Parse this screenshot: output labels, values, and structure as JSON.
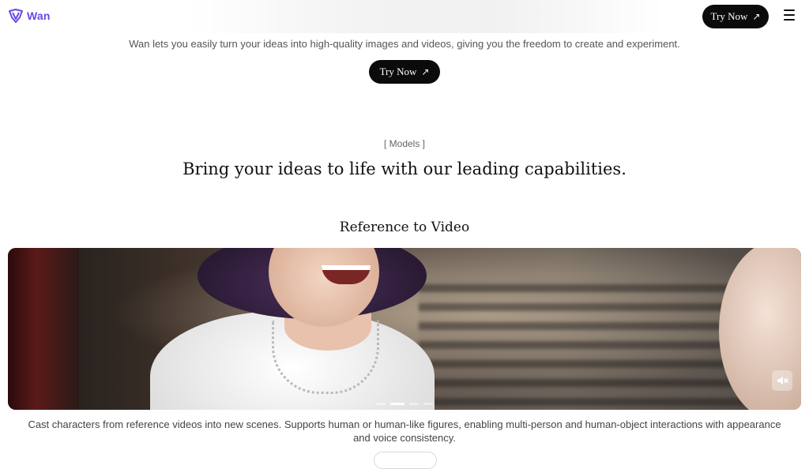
{
  "header": {
    "brand": "Wan",
    "try_now_label": "Try Now",
    "menu_icon": "hamburger-menu-icon"
  },
  "hero": {
    "description": "Wan lets you easily turn your ideas into high-quality images and videos, giving you the freedom to create and experiment.",
    "try_now_label": "Try Now",
    "button_icon": "arrow-up-right-icon"
  },
  "models": {
    "eyebrow": "[ Models ]",
    "headline": "Bring your ideas to life with our leading capabilities."
  },
  "feature": {
    "title": "Reference to Video",
    "description": "Cast characters from reference videos into new scenes. Supports human or human-like figures, enabling multi-person and human-object interactions with appearance and voice consistency.",
    "carousel": {
      "total": 5,
      "active": 2
    },
    "mute_icon": "speaker-muted-icon"
  },
  "colors": {
    "brand": "#6b48e6",
    "button_bg": "#0b0b0b",
    "text_muted": "#555555"
  }
}
